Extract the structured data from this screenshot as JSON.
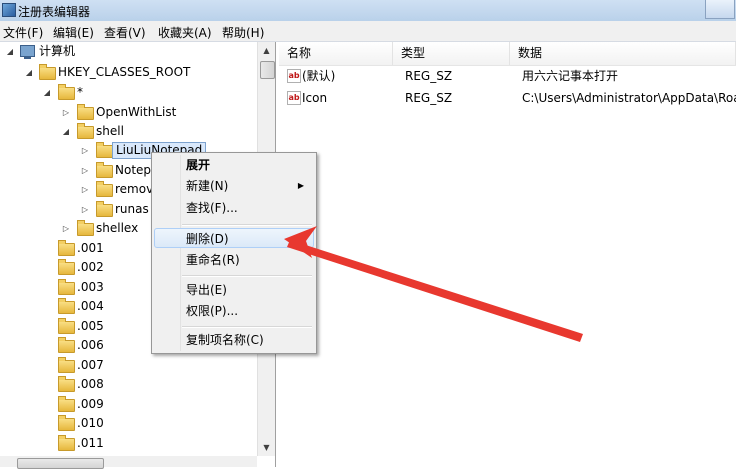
{
  "window": {
    "title": "注册表编辑器"
  },
  "menubar": {
    "items": [
      "文件(F)",
      "编辑(E)",
      "查看(V)",
      "收藏夹(A)",
      "帮助(H)"
    ]
  },
  "tree": {
    "root": "计算机",
    "hive": "HKEY_CLASSES_ROOT",
    "star": "*",
    "openwithlist": "OpenWithList",
    "shell": "shell",
    "selected": "LiuLiuNotepad",
    "notepad": "Notep",
    "remove": "remov",
    "runas": "runas",
    "shellex": "shellex",
    "extensions": [
      ".001",
      ".002",
      ".003",
      ".004",
      ".005",
      ".006",
      ".007",
      ".008",
      ".009",
      ".010",
      ".011"
    ]
  },
  "list": {
    "headers": {
      "name": "名称",
      "type": "类型",
      "data": "数据"
    },
    "rows": [
      {
        "icon": "string-value-icon",
        "name": "(默认)",
        "type": "REG_SZ",
        "data": "用六六记事本打开"
      },
      {
        "icon": "string-value-icon",
        "name": "Icon",
        "type": "REG_SZ",
        "data": "C:\\Users\\Administrator\\AppData\\Roa"
      }
    ]
  },
  "context_menu": {
    "expand": "展开",
    "new": "新建(N)",
    "find": "查找(F)...",
    "delete": "删除(D)",
    "rename": "重命名(R)",
    "export": "导出(E)",
    "permissions": "权限(P)...",
    "copy_key_name": "复制项名称(C)"
  },
  "colors": {
    "annotation_arrow": "#e8382f",
    "selection": "#d9e8fb"
  }
}
